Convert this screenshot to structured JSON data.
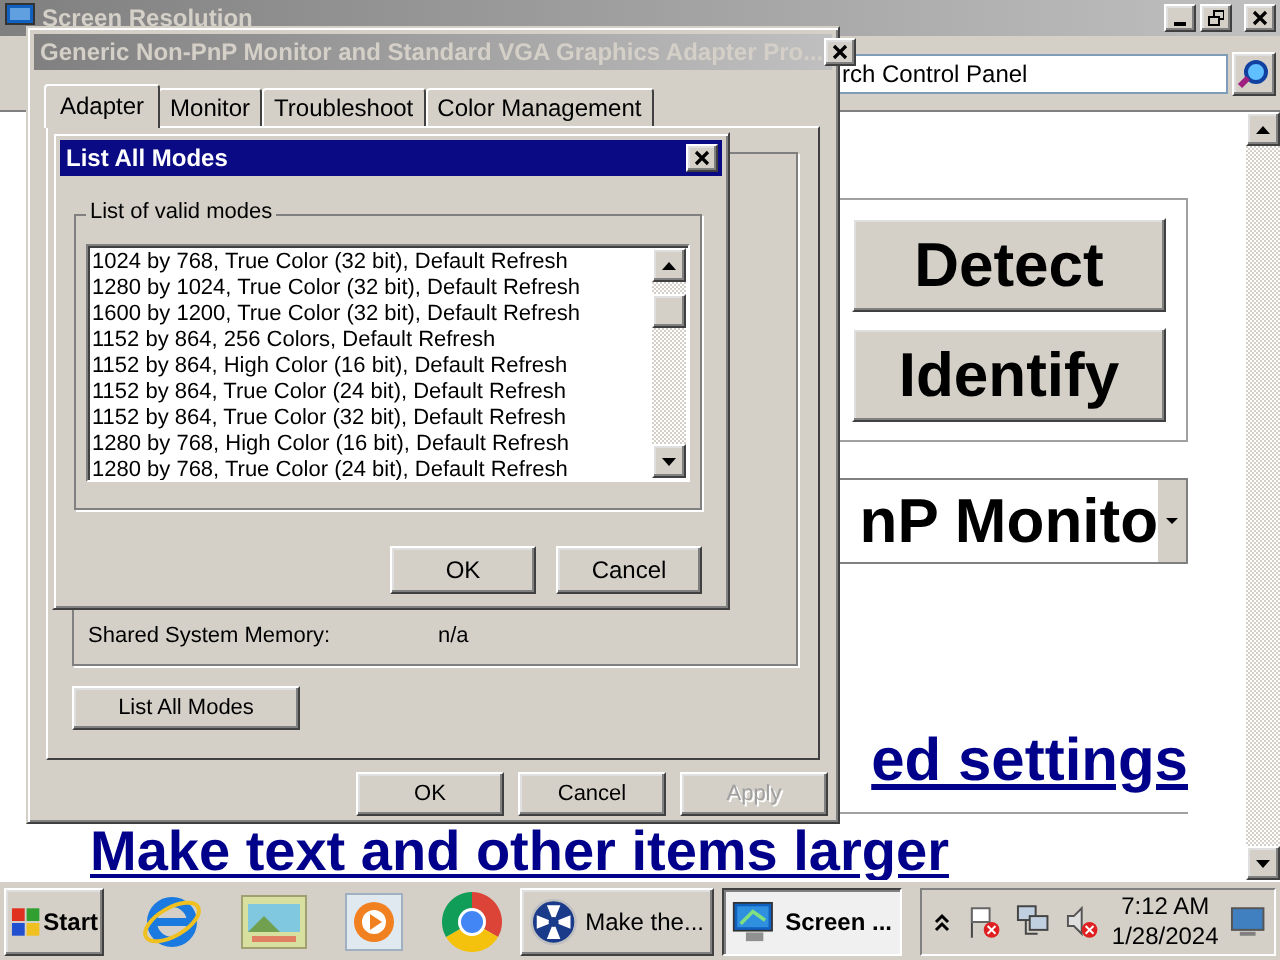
{
  "background_window": {
    "title": "Screen Resolution",
    "address_text": "rch Control Panel",
    "detect_button": "Detect",
    "identify_button": "Identify",
    "display_dropdown": "nP Monito",
    "advanced_link": "ed settings",
    "text_size_link": "Make text and other items larger"
  },
  "properties_dialog": {
    "title": "Generic Non-PnP Monitor and Standard VGA Graphics Adapter Pro...",
    "tabs": [
      {
        "label": "Adapter",
        "selected": true
      },
      {
        "label": "Monitor",
        "selected": false
      },
      {
        "label": "Troubleshoot",
        "selected": false
      },
      {
        "label": "Color Management",
        "selected": false
      }
    ],
    "info_rows": [
      {
        "label": "Shared System Memory:",
        "value": "n/a"
      }
    ],
    "list_all_modes_button": "List All Modes",
    "buttons": [
      {
        "label": "OK",
        "disabled": false
      },
      {
        "label": "Cancel",
        "disabled": false
      },
      {
        "label": "Apply",
        "disabled": true
      }
    ]
  },
  "list_modes_dialog": {
    "title": "List All Modes",
    "group_label": "List of valid modes",
    "modes": [
      {
        "text": "1024 by 768, True Color (32 bit), Default Refresh",
        "selected": false
      },
      {
        "text": "1280 by 1024, True Color (32 bit), Default Refresh",
        "selected": false
      },
      {
        "text": "1600 by 1200, True Color (32 bit), Default Refresh",
        "selected": false
      },
      {
        "text": "1152 by 864, 256 Colors, Default Refresh",
        "selected": false
      },
      {
        "text": "1152 by 864, High Color (16 bit), Default Refresh",
        "selected": false
      },
      {
        "text": "1152 by 864, True Color (24 bit), Default Refresh",
        "selected": false
      },
      {
        "text": "1152 by 864, True Color (32 bit), Default Refresh",
        "selected": false
      },
      {
        "text": "1280 by 768, High Color (16 bit), Default Refresh",
        "selected": false
      },
      {
        "text": "1280 by 768, True Color (24 bit), Default Refresh",
        "selected": false
      }
    ],
    "buttons": [
      "OK",
      "Cancel"
    ]
  },
  "taskbar": {
    "start": "Start",
    "tasks": [
      {
        "label": "Make the...",
        "selected": false
      },
      {
        "label": "Screen ...",
        "selected": true
      }
    ],
    "clock_time": "7:12 AM",
    "clock_date": "1/28/2024"
  }
}
